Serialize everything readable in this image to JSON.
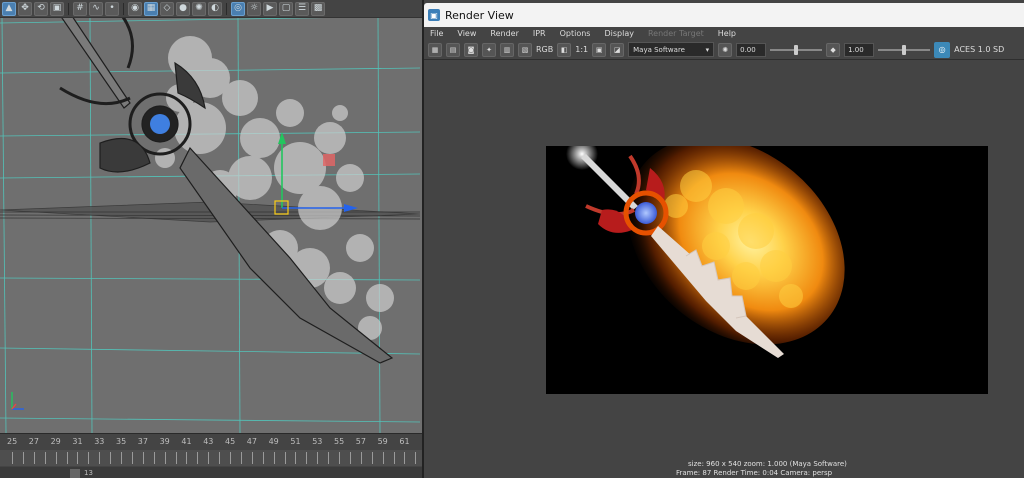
{
  "viewport": {
    "toolbar_icons": [
      "select-icon",
      "move-icon",
      "rotate-icon",
      "scale-icon",
      "snap-grid-icon",
      "snap-curve-icon",
      "snap-point-icon",
      "camera-icon",
      "grid-icon",
      "wireframe-icon",
      "smooth-shade-icon",
      "light-icon",
      "shadow-icon",
      "isolate-icon",
      "xray-icon",
      "camera-attr-icon"
    ],
    "timeline": {
      "ticks": [
        "25",
        "27",
        "29",
        "31",
        "33",
        "35",
        "37",
        "39",
        "41",
        "43",
        "45",
        "47",
        "49",
        "51",
        "53",
        "55",
        "57",
        "59",
        "61"
      ],
      "range_value": "13"
    }
  },
  "render_view": {
    "title": "Render View",
    "menu": [
      "File",
      "View",
      "Render",
      "IPR",
      "Options",
      "Display",
      "Render Target",
      "Help"
    ],
    "menu_disabled": [
      "Render Target"
    ],
    "toolbar": {
      "rgb_label": "RGB",
      "ratio_label": "1:1",
      "renderer": "Maya Software",
      "exposure": "0.00",
      "exposure_level": 0.5,
      "gamma": "1.00",
      "gamma_level": 0.5,
      "color_space": "ACES 1.0 SD"
    },
    "status": {
      "line1": "size: 960 x 540 zoom: 1.000     (Maya Software)",
      "line2": "Frame: 87       Render Time: 0:04       Camera: persp"
    }
  },
  "colors": {
    "viewport_bg": "#6e6e6e",
    "grid_line": "#4fd1c5",
    "accent": "#3c89b8",
    "fire_core": "#ffd24a",
    "fire_outer": "#e25c00"
  }
}
